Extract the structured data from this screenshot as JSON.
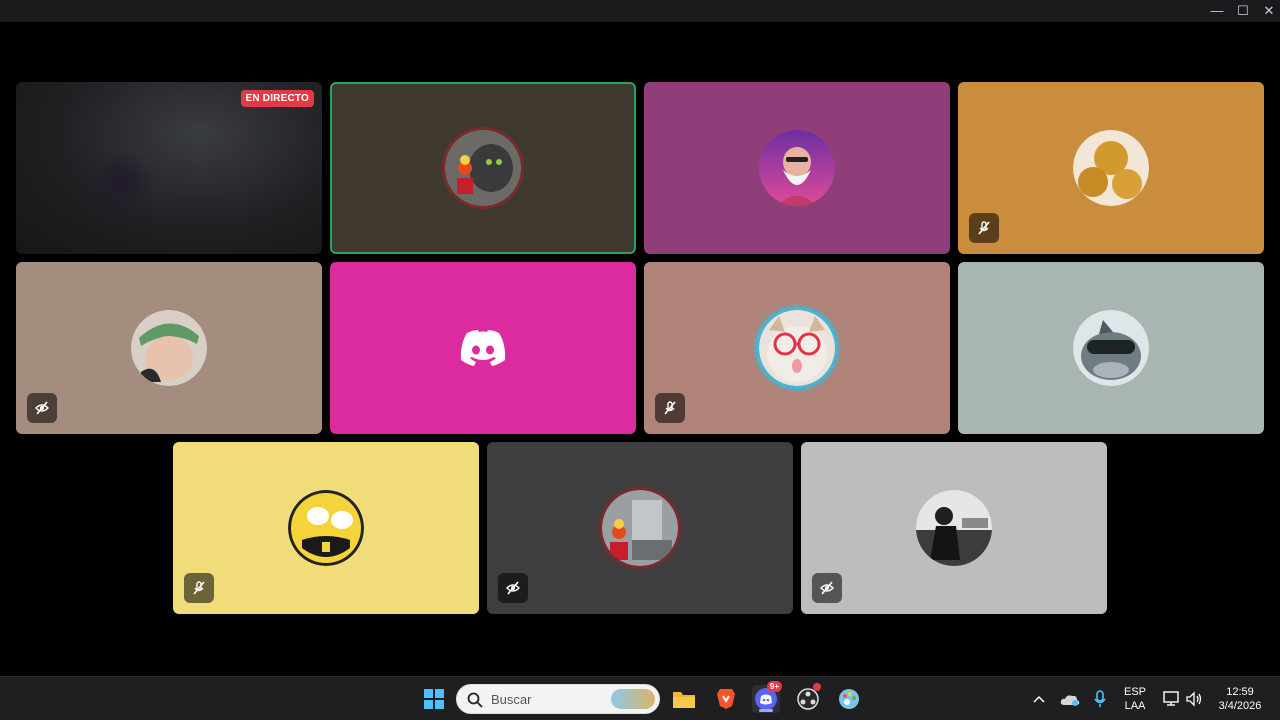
{
  "window": {
    "controls": [
      "—",
      "☐",
      "✕"
    ]
  },
  "tiles": [
    {
      "id": "stream",
      "bg": "#202224",
      "badge": "EN DIRECTO",
      "muted": false,
      "speaking": false
    },
    {
      "id": "user-cat-speaking",
      "bg": "#403930",
      "muted": false,
      "speaking": true,
      "avatar": "cat-figure"
    },
    {
      "id": "user-old-man",
      "bg": "#8f3e79",
      "muted": false,
      "speaking": false,
      "avatar": "old-man"
    },
    {
      "id": "user-balls",
      "bg": "#c98d3d",
      "muted": true,
      "speaking": false,
      "avatar": "food-balls"
    },
    {
      "id": "user-cap",
      "bg": "#a48d7e",
      "muted": true,
      "speaking": false,
      "avatar": "person-cap"
    },
    {
      "id": "user-discord-default",
      "bg": "#dc2b9e",
      "muted": false,
      "speaking": false,
      "avatar": "discord-logo"
    },
    {
      "id": "user-cat-glasses",
      "bg": "#b08478",
      "muted": true,
      "speaking": false,
      "avatar": "cat-glasses"
    },
    {
      "id": "user-dolphin",
      "bg": "#a9b5b1",
      "muted": false,
      "speaking": false,
      "avatar": "dolphin-goggles"
    },
    {
      "id": "user-face-glasses",
      "bg": "#f0dd7a",
      "muted": true,
      "speaking": false,
      "avatar": "cartoon-face"
    },
    {
      "id": "user-figure-room",
      "bg": "#3e3e41",
      "muted": true,
      "speaking": false,
      "avatar": "figure-room"
    },
    {
      "id": "user-bw-photo",
      "bg": "#bdbdbd",
      "muted": true,
      "speaking": false,
      "avatar": "bw-photo"
    }
  ],
  "taskbar": {
    "search_placeholder": "Buscar",
    "discord_badge": "9+",
    "language": "ESP",
    "layout": "LAA",
    "time": "12:59",
    "date": "3/4/2026"
  }
}
